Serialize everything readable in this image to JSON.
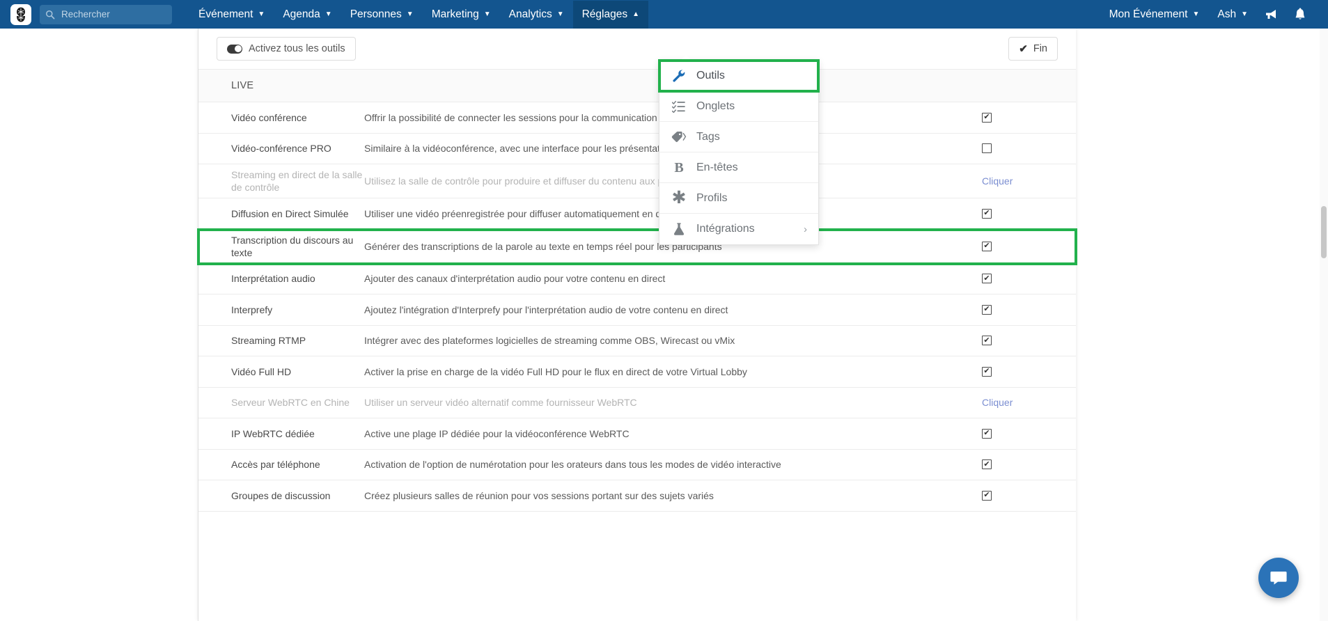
{
  "navbar": {
    "logo_alt": "app-logo",
    "search": {
      "placeholder": "Rechercher",
      "value": ""
    },
    "menus": [
      {
        "label": "Événement",
        "caret": "⌄"
      },
      {
        "label": "Agenda",
        "caret": "⌄"
      },
      {
        "label": "Personnes",
        "caret": "⌄"
      },
      {
        "label": "Marketing",
        "caret": "⌄"
      },
      {
        "label": "Analytics",
        "caret": "⌄"
      },
      {
        "label": "Réglages",
        "caret": "⌃"
      }
    ],
    "right": [
      {
        "label": "Mon Événement",
        "caret": "⌄"
      },
      {
        "label": "Ash",
        "caret": "⌄"
      }
    ],
    "icons": [
      "megaphone-icon",
      "bell-icon"
    ]
  },
  "dropdown": {
    "items": [
      {
        "label": "Outils",
        "icon": "wrench-icon",
        "selected": true,
        "submenu": false
      },
      {
        "label": "Onglets",
        "icon": "list-icon",
        "selected": false,
        "submenu": false
      },
      {
        "label": "Tags",
        "icon": "tag-icon",
        "selected": false,
        "submenu": false
      },
      {
        "label": "En-têtes",
        "icon": "bold-b-icon",
        "selected": false,
        "submenu": false
      },
      {
        "label": "Profils",
        "icon": "asterisk-icon",
        "selected": false,
        "submenu": false
      },
      {
        "label": "Intégrations",
        "icon": "flask-icon",
        "selected": false,
        "submenu": true,
        "submenu_caret": "›"
      }
    ]
  },
  "toolbar": {
    "toggle_all_label": "Activez tous les outils",
    "done_label": "Fin",
    "done_check": "✔"
  },
  "section": {
    "title": "LIVE"
  },
  "colors": {
    "navbar_bg": "#13558f",
    "highlight_green": "#22b14c",
    "link_blue": "#7b8ed1",
    "chat_blue": "#2b73b8"
  },
  "table": {
    "rows": [
      {
        "name": "Vidéo conférence",
        "desc": "Offrir la possibilité de connecter les sessions pour la communication en temps réel",
        "control": "checkbox",
        "checked": true,
        "disabled": false,
        "highlight": false
      },
      {
        "name": "Vidéo-conférence PRO",
        "desc": "Similaire à la vidéoconférence, avec une interface pour les présentateurs",
        "control": "checkbox",
        "checked": false,
        "disabled": false,
        "highlight": false
      },
      {
        "name": "Streaming en direct de la salle de contrôle",
        "desc": "Utilisez la salle de contrôle pour produire et diffuser du contenu aux participants",
        "control": "link",
        "link_label": "Cliquer",
        "checked": false,
        "disabled": true,
        "highlight": false
      },
      {
        "name": "Diffusion en Direct Simulée",
        "desc": "Utiliser une vidéo préenregistrée pour diffuser automatiquement en direct les dates de la session",
        "control": "checkbox",
        "checked": true,
        "disabled": false,
        "highlight": false
      },
      {
        "name": "Transcription du discours au texte",
        "desc": "Générer des transcriptions de la parole au texte en temps réel pour les participants",
        "control": "checkbox",
        "checked": true,
        "disabled": false,
        "highlight": true
      },
      {
        "name": "Interprétation audio",
        "desc": "Ajouter des canaux d'interprétation audio pour votre contenu en direct",
        "control": "checkbox",
        "checked": true,
        "disabled": false,
        "highlight": false
      },
      {
        "name": "Interprefy",
        "desc": "Ajoutez l'intégration d'Interprefy pour l'interprétation audio de votre contenu en direct",
        "control": "checkbox",
        "checked": true,
        "disabled": false,
        "highlight": false
      },
      {
        "name": "Streaming RTMP",
        "desc": "Intégrer avec des plateformes logicielles de streaming comme OBS, Wirecast ou vMix",
        "control": "checkbox",
        "checked": true,
        "disabled": false,
        "highlight": false
      },
      {
        "name": "Vidéo Full HD",
        "desc": "Activer la prise en charge de la vidéo Full HD pour le flux en direct de votre Virtual Lobby",
        "control": "checkbox",
        "checked": true,
        "disabled": false,
        "highlight": false
      },
      {
        "name": "Serveur WebRTC en Chine",
        "desc": "Utiliser un serveur vidéo alternatif comme fournisseur WebRTC",
        "control": "link",
        "link_label": "Cliquer",
        "checked": false,
        "disabled": true,
        "highlight": false
      },
      {
        "name": "IP WebRTC dédiée",
        "desc": "Active une plage IP dédiée pour la vidéoconférence WebRTC",
        "control": "checkbox",
        "checked": true,
        "disabled": false,
        "highlight": false
      },
      {
        "name": "Accès par téléphone",
        "desc": "Activation de l'option de numérotation pour les orateurs dans tous les modes de vidéo interactive",
        "control": "checkbox",
        "checked": true,
        "disabled": false,
        "highlight": false
      },
      {
        "name": "Groupes de discussion",
        "desc": "Créez plusieurs salles de réunion pour vos sessions portant sur des sujets variés",
        "control": "checkbox",
        "checked": true,
        "disabled": false,
        "highlight": false
      }
    ]
  },
  "chat": {
    "icon": "chat-bubble-icon"
  },
  "checkbox_glyph": "✔"
}
